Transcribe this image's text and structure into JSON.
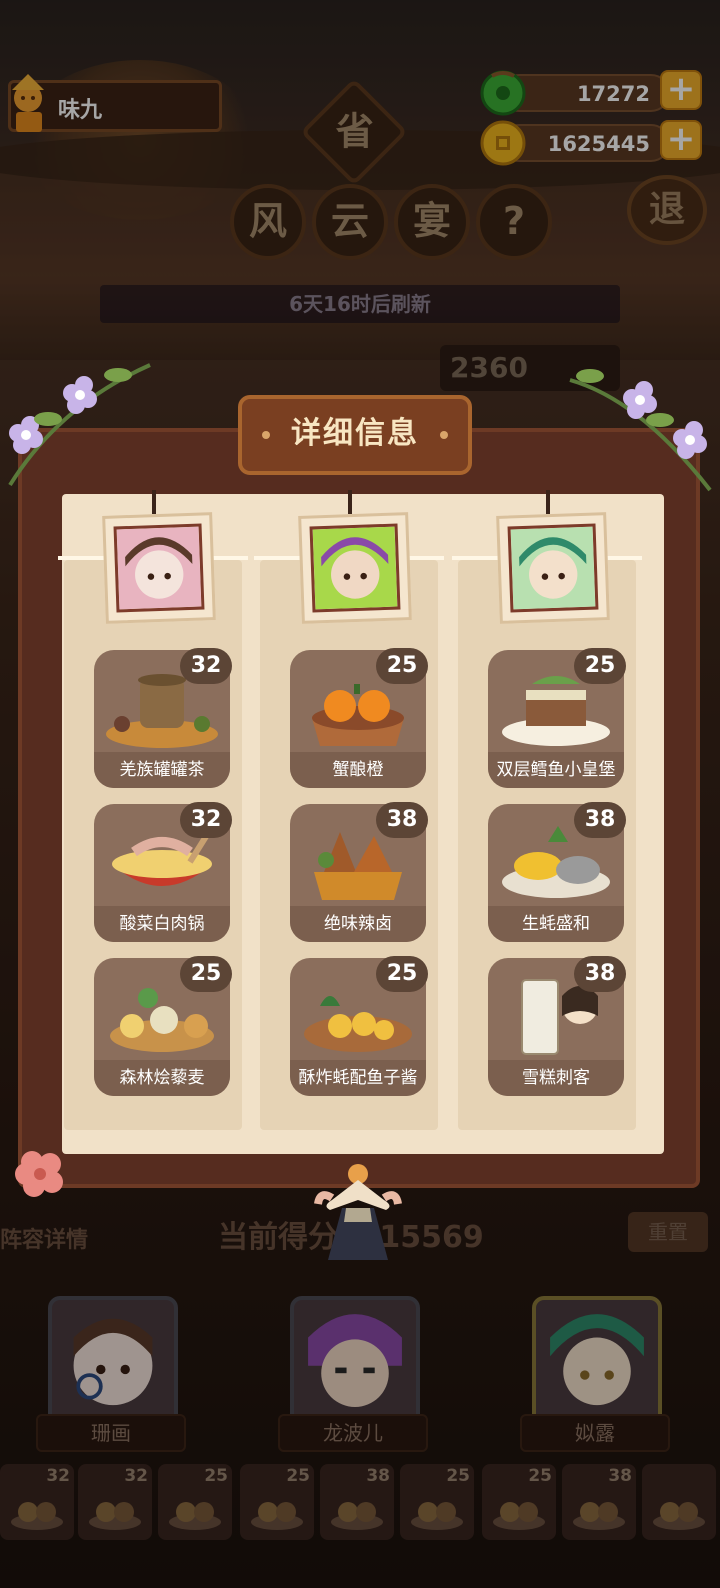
{
  "player": {
    "name": "味九",
    "avatar_icon": "chef-figure-icon"
  },
  "resources": {
    "jade": {
      "value": "17272",
      "icon": "jade-coin-icon",
      "color": "#3db036"
    },
    "gold": {
      "value": "1625445",
      "icon": "gold-coin-icon",
      "color": "#f1b71e"
    },
    "add_label": "+"
  },
  "event": {
    "province_badge": "省",
    "title_chars": [
      "风",
      "云",
      "宴"
    ],
    "help_label": "?",
    "exit_label": "退",
    "refresh_text": "6天16时后刷新",
    "score_partial": "2360"
  },
  "modal": {
    "title": "详细信息",
    "columns": [
      {
        "chef_avatar": "chef-shanhua-icon",
        "dishes": [
          {
            "name": "羌族罐罐茶",
            "score": "32"
          },
          {
            "name": "酸菜白肉锅",
            "score": "32"
          },
          {
            "name": "森林烩藜麦",
            "score": "25"
          }
        ]
      },
      {
        "chef_avatar": "chef-longboer-icon",
        "dishes": [
          {
            "name": "蟹酿橙",
            "score": "25"
          },
          {
            "name": "绝味辣卤",
            "score": "38"
          },
          {
            "name": "酥炸蚝配鱼子酱",
            "score": "25"
          }
        ]
      },
      {
        "chef_avatar": "chef-silu-icon",
        "dishes": [
          {
            "name": "双层鳕鱼小皇堡",
            "score": "25"
          },
          {
            "name": "生蚝盛和",
            "score": "38"
          },
          {
            "name": "雪糕刺客",
            "score": "38"
          }
        ]
      }
    ]
  },
  "summary": {
    "left_label": "阵容详情",
    "score_label": "当前得分",
    "score_value": "315569",
    "right_label": "重置"
  },
  "chefs": [
    {
      "name": "珊画"
    },
    {
      "name": "龙波儿"
    },
    {
      "name": "姒露"
    }
  ],
  "dish_strip": [
    "32",
    "32",
    "25",
    "25",
    "38",
    "25",
    "25",
    "38",
    ""
  ]
}
